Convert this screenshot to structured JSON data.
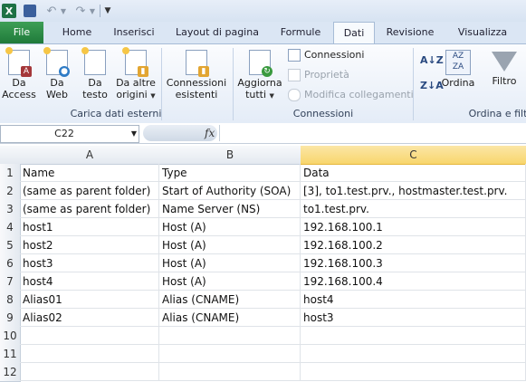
{
  "titlebar": {
    "app_logo": "X",
    "icons": [
      "excel-icon",
      "save-icon",
      "undo-icon",
      "redo-icon",
      "customize-icon"
    ]
  },
  "tabs": [
    {
      "label": "File"
    },
    {
      "label": "Home"
    },
    {
      "label": "Inserisci"
    },
    {
      "label": "Layout di pagina"
    },
    {
      "label": "Formule"
    },
    {
      "label": "Dati"
    },
    {
      "label": "Revisione"
    },
    {
      "label": "Visualizza"
    }
  ],
  "ribbon": {
    "groups": {
      "external_label": "Carica dati esterni",
      "connections_label": "Connessioni",
      "sort_label": "Ordina e filt"
    },
    "buttons": {
      "access": {
        "line1": "Da",
        "line2": "Access"
      },
      "web": {
        "line1": "Da",
        "line2": "Web"
      },
      "text": {
        "line1": "Da",
        "line2": "testo"
      },
      "other": {
        "line1": "Da altre",
        "line2": "origini"
      },
      "existing": {
        "line1": "Connessioni",
        "line2": "esistenti"
      },
      "refresh": {
        "line1": "Aggiorna",
        "line2": "tutti"
      },
      "connections": "Connessioni",
      "properties": "Proprietà",
      "edit_links": "Modifica collegamenti",
      "sort": "Ordina",
      "filter": "Filtro"
    }
  },
  "formula_bar": {
    "name_box": "C22",
    "fx_label": "fx",
    "value": ""
  },
  "sheet": {
    "columns": [
      "A",
      "B",
      "C"
    ],
    "selected_column": "C",
    "row_numbers": [
      "1",
      "2",
      "3",
      "4",
      "5",
      "6",
      "7",
      "8",
      "9",
      "10",
      "11",
      "12"
    ],
    "rows": [
      [
        "Name",
        "Type",
        "Data"
      ],
      [
        "(same as parent folder)",
        "Start of Authority (SOA)",
        "[3], to1.test.prv., hostmaster.test.prv."
      ],
      [
        "(same as parent folder)",
        "Name Server (NS)",
        "to1.test.prv."
      ],
      [
        "host1",
        "Host (A)",
        "192.168.100.1"
      ],
      [
        "host2",
        "Host (A)",
        "192.168.100.2"
      ],
      [
        "host3",
        "Host (A)",
        "192.168.100.3"
      ],
      [
        "host4",
        "Host (A)",
        "192.168.100.4"
      ],
      [
        "Alias01",
        "Alias (CNAME)",
        "host4"
      ],
      [
        "Alias02",
        "Alias (CNAME)",
        "host3"
      ],
      [
        "",
        "",
        ""
      ],
      [
        "",
        "",
        ""
      ],
      [
        "",
        "",
        ""
      ]
    ]
  }
}
